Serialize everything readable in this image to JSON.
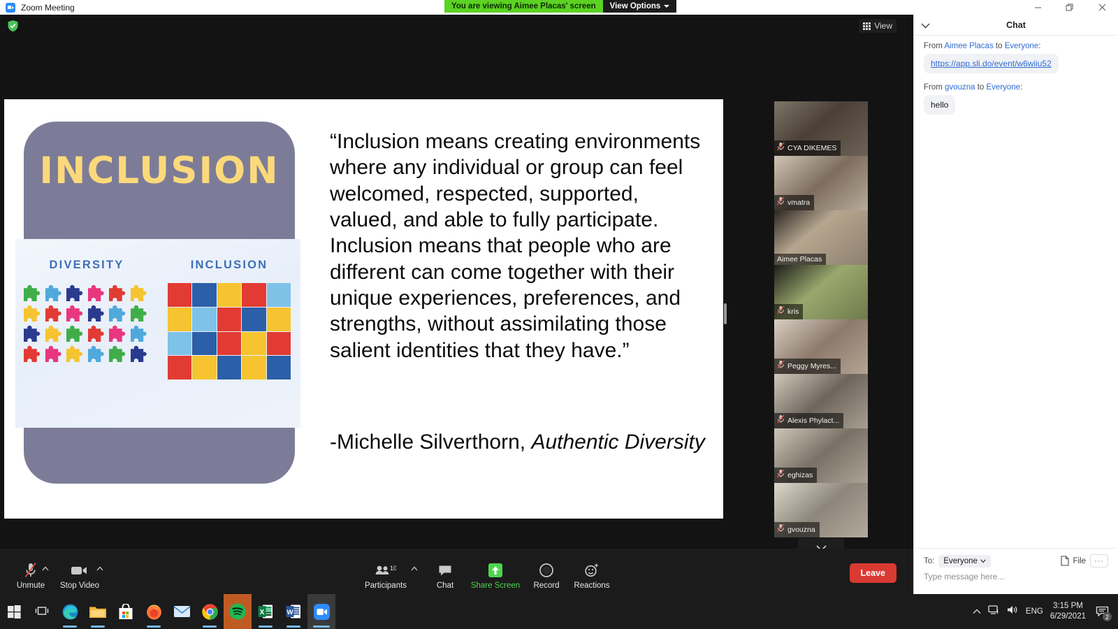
{
  "window": {
    "title": "Zoom Meeting",
    "app_icon": "zoom-camera-icon",
    "minimize": "minimize-icon",
    "restore": "restore-icon",
    "close": "close-icon"
  },
  "share_banner": {
    "notice": "You are viewing Aimee Placas' screen",
    "view_options": "View Options"
  },
  "meeting": {
    "encryption_icon": "green-shield-icon",
    "view_button": "View",
    "scroll_down_icon": "chevron-down-icon"
  },
  "slide": {
    "card_title": "INCLUSION",
    "image": {
      "left_label": "DIVERSITY",
      "right_label": "INCLUSION"
    },
    "quote": "“Inclusion means creating environments where any individual or group can feel welcomed, respected, supported, valued, and able to fully participate. Inclusion means that people who are different can come together with their unique experiences, preferences, and strengths, without assimilating those salient identities that they have.”",
    "attribution_author": "-Michelle Silverthorn, ",
    "attribution_book": "Authentic Diversity",
    "colors": {
      "card_bg": "#7D7C98",
      "card_title": "#FBD97B",
      "label_blue": "#3E6FB8"
    }
  },
  "participants": [
    {
      "name": "CYA DIKEMES",
      "muted": true,
      "active": false
    },
    {
      "name": "vmatra",
      "muted": true,
      "active": false
    },
    {
      "name": "Aimee Placas",
      "muted": false,
      "active": true
    },
    {
      "name": "kris",
      "muted": true,
      "active": false
    },
    {
      "name": "Peggy Myres...",
      "muted": true,
      "active": false
    },
    {
      "name": "Alexis Phylact...",
      "muted": true,
      "active": false
    },
    {
      "name": "eghizas",
      "muted": true,
      "active": false
    },
    {
      "name": "gvouzna",
      "muted": true,
      "active": false
    }
  ],
  "toolbar": {
    "items": [
      {
        "label": "Unmute",
        "icon": "microphone-muted-icon",
        "has_caret": true,
        "highlight": false
      },
      {
        "label": "Stop Video",
        "icon": "video-camera-icon",
        "has_caret": true,
        "highlight": false
      },
      {
        "label": "Participants",
        "icon": "people-icon",
        "has_caret": true,
        "highlight": false,
        "count": "10"
      },
      {
        "label": "Chat",
        "icon": "speech-bubble-icon",
        "has_caret": false,
        "highlight": false
      },
      {
        "label": "Share Screen",
        "icon": "share-screen-up-arrow-icon",
        "has_caret": false,
        "highlight": true
      },
      {
        "label": "Record",
        "icon": "record-circle-icon",
        "has_caret": false,
        "highlight": false
      },
      {
        "label": "Reactions",
        "icon": "smiley-plus-icon",
        "has_caret": false,
        "highlight": false
      }
    ],
    "leave_label": "Leave"
  },
  "chat": {
    "title": "Chat",
    "collapse_icon": "chevron-down-icon",
    "messages": [
      {
        "from_prefix": "From ",
        "sender": "Aimee Placas",
        "to_middle": " to ",
        "recipient": "Everyone",
        "colon": ":",
        "text": "https://app.sli.do/event/w6wiiu52",
        "is_link": true
      },
      {
        "from_prefix": "From ",
        "sender": "gvouzna",
        "to_middle": " to ",
        "recipient": "Everyone",
        "colon": ":",
        "text": "hello",
        "is_link": false
      }
    ],
    "footer": {
      "to_label": "To:",
      "to_value": "Everyone",
      "file_label": "File",
      "more_label": "···",
      "input_placeholder": "Type message here..."
    }
  },
  "taskbar": {
    "apps": [
      {
        "name": "start-button",
        "icon": "windows-logo-icon",
        "running": false
      },
      {
        "name": "task-view-button",
        "icon": "task-view-icon",
        "running": false
      },
      {
        "name": "edge",
        "icon": "edge-icon",
        "running": true
      },
      {
        "name": "file-explorer",
        "icon": "folder-icon",
        "running": true
      },
      {
        "name": "microsoft-store",
        "icon": "store-bag-icon",
        "running": false
      },
      {
        "name": "firefox",
        "icon": "firefox-icon",
        "running": true
      },
      {
        "name": "mail",
        "icon": "mail-envelope-icon",
        "running": false
      },
      {
        "name": "chrome",
        "icon": "chrome-icon",
        "running": true
      },
      {
        "name": "spotify",
        "icon": "spotify-icon",
        "running": true
      },
      {
        "name": "excel",
        "icon": "excel-icon",
        "running": true
      },
      {
        "name": "word",
        "icon": "word-icon",
        "running": true
      },
      {
        "name": "zoom",
        "icon": "zoom-camera-icon",
        "running": true
      }
    ],
    "tray": {
      "show_hidden_icon": "chevron-up-icon",
      "network_icon": "network-icon",
      "volume_icon": "speaker-icon",
      "language": "ENG",
      "time": "3:15 PM",
      "date": "6/29/2021",
      "notification_icon": "notifications-icon",
      "notification_count": "2"
    }
  }
}
